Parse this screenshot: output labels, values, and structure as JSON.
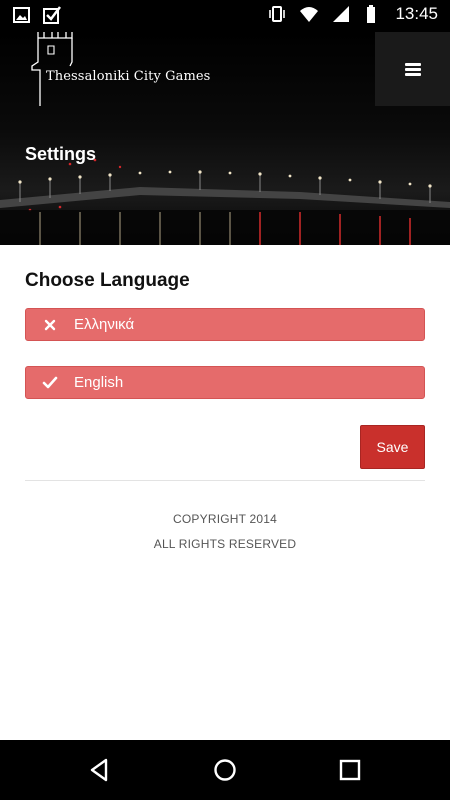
{
  "status_bar": {
    "time": "13:45",
    "left_icons": [
      "image-icon",
      "checkbox-icon"
    ],
    "right_icons": [
      "vibrate-icon",
      "wifi-icon",
      "signal-icon",
      "battery-icon"
    ]
  },
  "header": {
    "brand": "Thessaloniki City Games",
    "menu_icon": "hamburger-menu-icon",
    "page_title": "Settings"
  },
  "language": {
    "title": "Choose Language",
    "options": [
      {
        "label": "Ελληνικά",
        "icon": "close-icon",
        "selected": false
      },
      {
        "label": "English",
        "icon": "check-icon",
        "selected": true
      }
    ],
    "save_label": "Save"
  },
  "footer": {
    "copyright": "COPYRIGHT 2014",
    "rights": "ALL RIGHTS RESERVED"
  },
  "colors": {
    "option_bg": "#e56b6b",
    "save_bg": "#c9302c",
    "header_bg": "#000000"
  },
  "nav_bar": {
    "icons": [
      "back-icon",
      "home-icon",
      "recents-icon"
    ]
  }
}
